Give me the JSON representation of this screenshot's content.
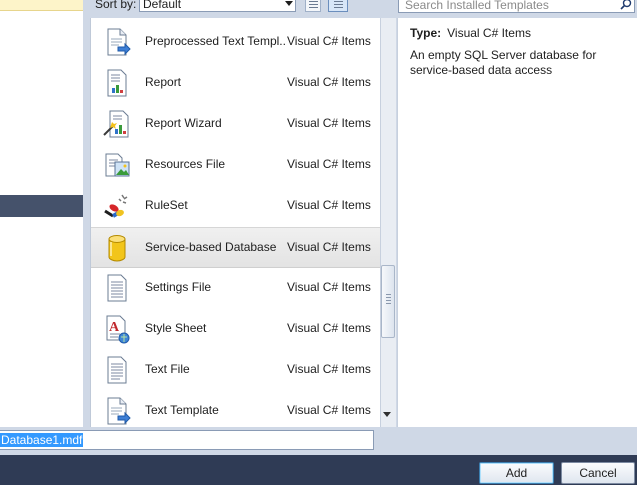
{
  "toolbar": {
    "sort_label": "Sort by:",
    "sort_value": "Default",
    "search_placeholder": "Search Installed Templates"
  },
  "templates": [
    {
      "name": "Preprocessed Text Templ...",
      "type": "Visual C# Items",
      "icon": "preprocessed-template-icon"
    },
    {
      "name": "Report",
      "type": "Visual C# Items",
      "icon": "report-icon"
    },
    {
      "name": "Report Wizard",
      "type": "Visual C# Items",
      "icon": "report-wizard-icon"
    },
    {
      "name": "Resources File",
      "type": "Visual C# Items",
      "icon": "resources-file-icon"
    },
    {
      "name": "RuleSet",
      "type": "Visual C# Items",
      "icon": "ruleset-icon"
    },
    {
      "name": "Service-based Database",
      "type": "Visual C# Items",
      "icon": "database-icon",
      "selected": true
    },
    {
      "name": "Settings File",
      "type": "Visual C# Items",
      "icon": "settings-file-icon"
    },
    {
      "name": "Style Sheet",
      "type": "Visual C# Items",
      "icon": "style-sheet-icon"
    },
    {
      "name": "Text File",
      "type": "Visual C# Items",
      "icon": "text-file-icon"
    },
    {
      "name": "Text Template",
      "type": "Visual C# Items",
      "icon": "text-template-icon"
    }
  ],
  "description": {
    "type_label": "Type:",
    "type_value": "Visual C# Items",
    "text": "An empty SQL Server database for service-based data access"
  },
  "name_field": {
    "value": "Database1.mdf"
  },
  "buttons": {
    "add": "Add",
    "cancel": "Cancel"
  },
  "colors": {
    "selection": "#3399ff",
    "bottom_bar": "#2f3b55"
  }
}
